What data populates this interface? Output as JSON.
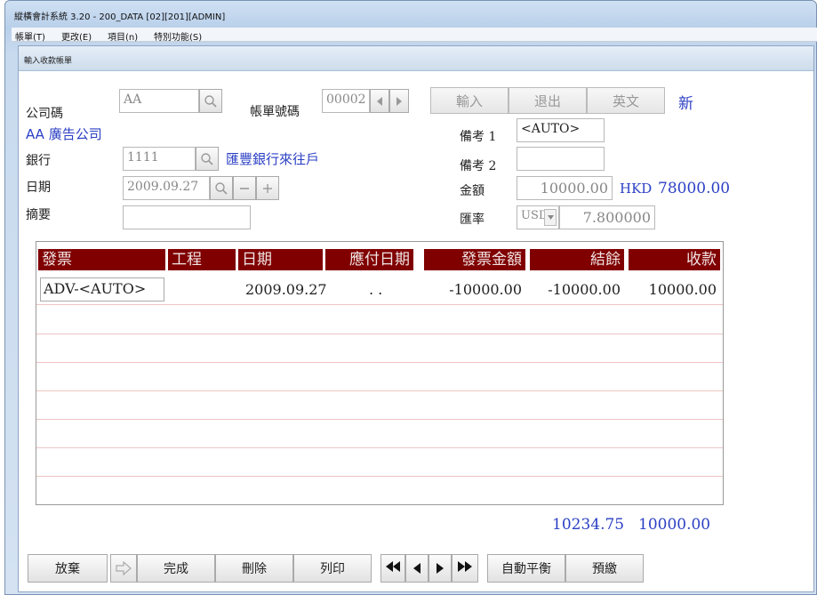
{
  "window": {
    "title": "縱橫會計系統 3.20 - 200_DATA [02][201][ADMIN]"
  },
  "menu": [
    {
      "label": "帳單(T)"
    },
    {
      "label": "更改(E)"
    },
    {
      "label": "項目(n)"
    },
    {
      "label": "特別功能(S)"
    }
  ],
  "form": {
    "title": "輸入收款帳單",
    "company_code_label": "公司碼",
    "company_code_value": "AA",
    "company_name": "AA 廣告公司",
    "bill_no_label": "帳單號碼",
    "bill_no_value": "00002",
    "input_label": "輸入",
    "exit_label": "退出",
    "english_label": "英文",
    "status_new": "新",
    "remark1_label": "備考 1",
    "remark1_value": "<AUTO>",
    "remark2_label": "備考 2",
    "remark2_value": "",
    "bank_label": "銀行",
    "bank_code_value": "1111",
    "bank_name": "匯豐銀行來往戶",
    "date_label": "日期",
    "date_value": "2009.09.27",
    "amount_label": "金額",
    "amount_value": "10000.00",
    "amount_currency": "HKD",
    "amount_converted": "78000.00",
    "summary_label": "摘要",
    "summary_value": "",
    "rate_label": "匯率",
    "rate_currency": "USD",
    "rate_value": "7.800000"
  },
  "grid": {
    "headers": [
      "發票",
      "工程",
      "日期",
      "應付日期",
      "發票金額",
      "結餘",
      "收款"
    ],
    "rows": [
      {
        "invoice": "ADV-<AUTO>",
        "project": "",
        "date": "2009.09.27",
        "due_date": ".   .",
        "invoice_amount": "-10000.00",
        "balance": "-10000.00",
        "receipt": "10000.00"
      }
    ]
  },
  "totals": {
    "balance_total": "10234.75",
    "receipt_total": "10000.00"
  },
  "buttons": {
    "abandon": "放棄",
    "complete": "完成",
    "delete": "刪除",
    "print": "列印",
    "auto_balance": "自動平衡",
    "prepay": "預繳"
  }
}
